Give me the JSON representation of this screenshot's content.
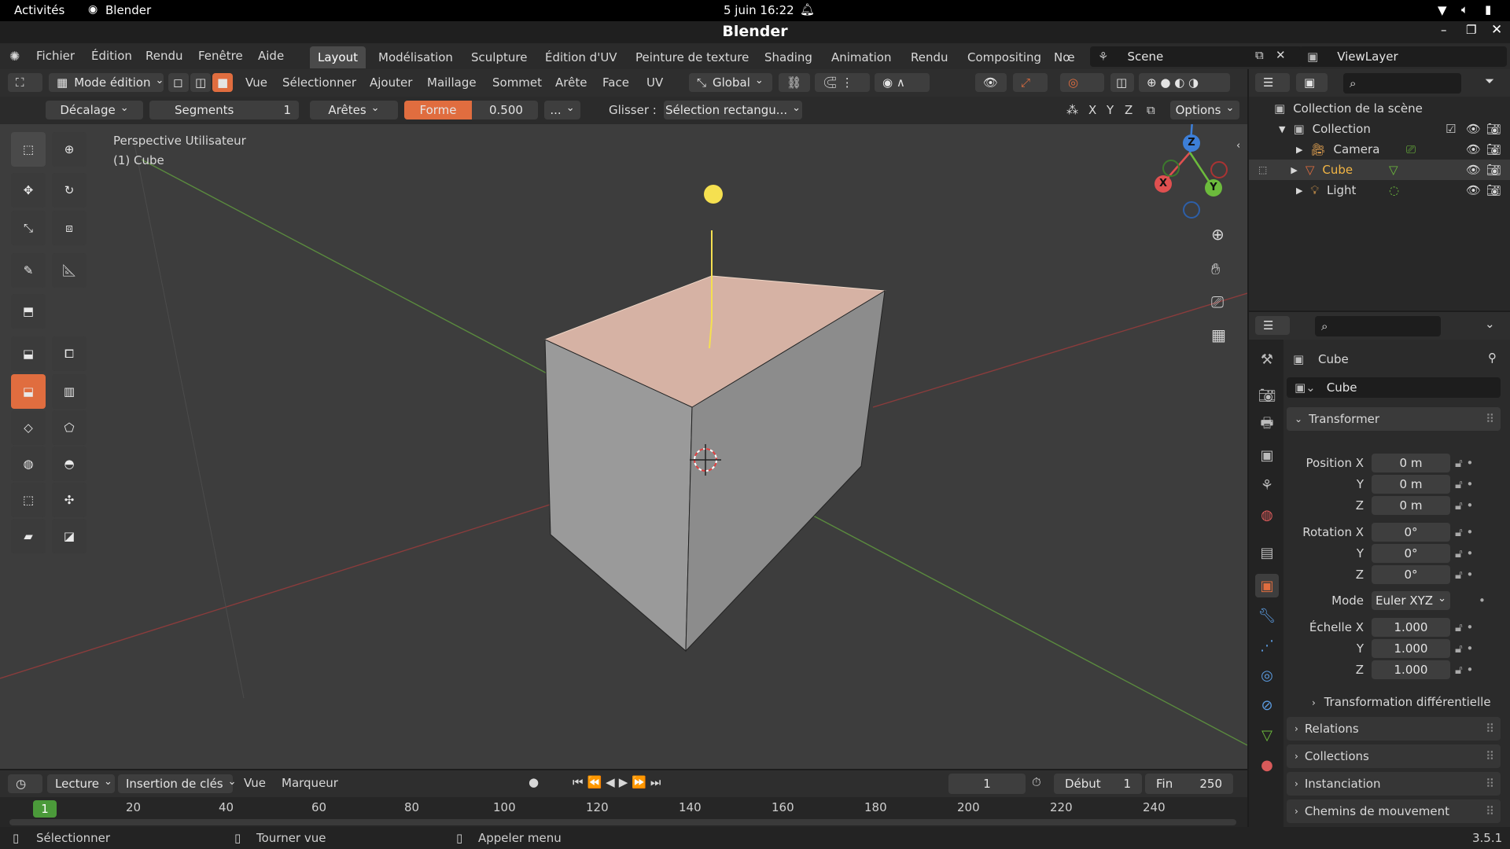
{
  "gnome": {
    "activities": "Activités",
    "app": "Blender",
    "clock": "5 juin  16:22"
  },
  "window": {
    "title": "Blender"
  },
  "menu": [
    "Fichier",
    "Édition",
    "Rendu",
    "Fenêtre",
    "Aide"
  ],
  "workspaces": [
    {
      "label": "Layout",
      "active": true
    },
    {
      "label": "Modélisation"
    },
    {
      "label": "Sculpture"
    },
    {
      "label": "Édition d'UV"
    },
    {
      "label": "Peinture de texture"
    },
    {
      "label": "Shading"
    },
    {
      "label": "Animation"
    },
    {
      "label": "Rendu"
    },
    {
      "label": "Compositing"
    },
    {
      "label": "Nœ"
    }
  ],
  "scene": {
    "name": "Scene",
    "viewlayer": "ViewLayer"
  },
  "header": {
    "mode": "Mode édition",
    "menus": [
      "Vue",
      "Sélectionner",
      "Ajouter",
      "Maillage",
      "Sommet",
      "Arête",
      "Face",
      "UV"
    ],
    "orientation": "Global"
  },
  "operator": {
    "offset": "Décalage",
    "segments_label": "Segments",
    "segments_value": "1",
    "affect": "Arêtes",
    "shape_label": "Forme",
    "shape_value": "0.500",
    "more": "...",
    "glisser_label": "Glisser :",
    "glisser_value": "Sélection rectangu...",
    "axes": [
      "X",
      "Y",
      "Z"
    ],
    "options": "Options"
  },
  "viewport": {
    "view_name": "Perspective Utilisateur",
    "object_name": "(1) Cube"
  },
  "outliner": {
    "root": "Collection de la scène",
    "collection": "Collection",
    "items": [
      {
        "name": "Camera",
        "icon": "camera-icon",
        "color": "#cfcfcf"
      },
      {
        "name": "Cube",
        "icon": "mesh-icon",
        "color": "#f2b544",
        "selected": true
      },
      {
        "name": "Light",
        "icon": "light-icon",
        "color": "#cfcfcf"
      }
    ]
  },
  "properties": {
    "object_title": "Cube",
    "object_name": "Cube",
    "transform_title": "Transformer",
    "location_label": "Position X",
    "location": [
      "0 m",
      "0 m",
      "0 m"
    ],
    "rotation_label": "Rotation X",
    "rotation": [
      "0°",
      "0°",
      "0°"
    ],
    "mode_label": "Mode",
    "mode_value": "Euler XYZ",
    "scale_label": "Échelle X",
    "scale": [
      "1.000",
      "1.000",
      "1.000"
    ],
    "y_label": "Y",
    "z_label": "Z",
    "delta": "Transformation différentielle",
    "sections": [
      "Relations",
      "Collections",
      "Instanciation",
      "Chemins de mouvement"
    ]
  },
  "timeline": {
    "menus": [
      "Lecture",
      "Insertion de clés",
      "Vue",
      "Marqueur"
    ],
    "current_frame": "1",
    "start_label": "Début",
    "start": "1",
    "end_label": "Fin",
    "end": "250",
    "ticks": [
      "20",
      "40",
      "60",
      "80",
      "100",
      "120",
      "140",
      "160",
      "180",
      "200",
      "220",
      "240"
    ],
    "playhead": "1"
  },
  "status": {
    "select": "Sélectionner",
    "rotate": "Tourner vue",
    "menu": "Appeler menu",
    "version": "3.5.1"
  },
  "colors": {
    "accent": "#e06d3f",
    "selection_yellow": "#f2b544",
    "active_face": "#d6b2a4"
  }
}
